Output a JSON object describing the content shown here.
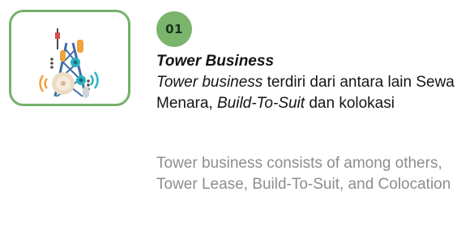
{
  "card": {
    "icon": "telecom-tower-icon",
    "border_color": "#74b26a"
  },
  "badge": {
    "number": "01",
    "color": "#7bb46b"
  },
  "heading": "Tower Business",
  "description_id": {
    "italic_lead": "Tower business",
    "part1": " terdiri dari antara lain Sewa Menara, ",
    "italic_mid": "Build-To-Suit",
    "part2": " dan kolokasi"
  },
  "description_en": "Tower business consists of among others, Tower Lease, Build-To-Suit, and Colocation"
}
